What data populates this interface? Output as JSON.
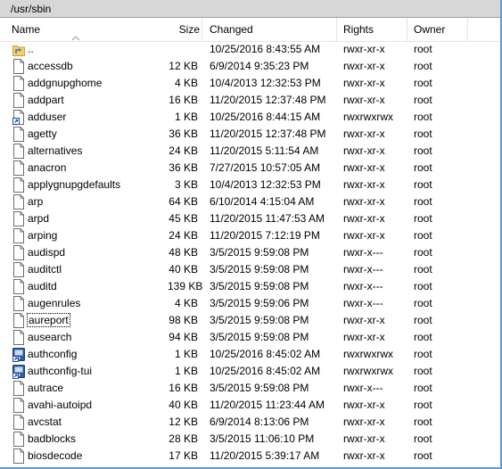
{
  "path": "/usr/sbin",
  "columns": {
    "name": "Name",
    "size": "Size",
    "changed": "Changed",
    "rights": "Rights",
    "owner": "Owner"
  },
  "files": [
    {
      "name": "..",
      "size": "",
      "changed": "10/25/2016 8:43:55 AM",
      "rights": "rwxr-xr-x",
      "owner": "root",
      "icon": "parent-folder-icon"
    },
    {
      "name": "accessdb",
      "size": "12 KB",
      "changed": "6/9/2014 9:35:23 PM",
      "rights": "rwxr-xr-x",
      "owner": "root",
      "icon": "file-icon"
    },
    {
      "name": "addgnupghome",
      "size": "4 KB",
      "changed": "10/4/2013 12:32:53 PM",
      "rights": "rwxr-xr-x",
      "owner": "root",
      "icon": "file-icon"
    },
    {
      "name": "addpart",
      "size": "16 KB",
      "changed": "11/20/2015 12:37:48 PM",
      "rights": "rwxr-xr-x",
      "owner": "root",
      "icon": "file-icon"
    },
    {
      "name": "adduser",
      "size": "1 KB",
      "changed": "10/25/2016 8:44:15 AM",
      "rights": "rwxrwxrwx",
      "owner": "root",
      "icon": "symlink-file-icon"
    },
    {
      "name": "agetty",
      "size": "36 KB",
      "changed": "11/20/2015 12:37:48 PM",
      "rights": "rwxr-xr-x",
      "owner": "root",
      "icon": "file-icon"
    },
    {
      "name": "alternatives",
      "size": "24 KB",
      "changed": "11/20/2015 5:11:54 AM",
      "rights": "rwxr-xr-x",
      "owner": "root",
      "icon": "file-icon"
    },
    {
      "name": "anacron",
      "size": "36 KB",
      "changed": "7/27/2015 10:57:05 AM",
      "rights": "rwxr-xr-x",
      "owner": "root",
      "icon": "file-icon"
    },
    {
      "name": "applygnupgdefaults",
      "size": "3 KB",
      "changed": "10/4/2013 12:32:53 PM",
      "rights": "rwxr-xr-x",
      "owner": "root",
      "icon": "file-icon"
    },
    {
      "name": "arp",
      "size": "64 KB",
      "changed": "6/10/2014 4:15:04 AM",
      "rights": "rwxr-xr-x",
      "owner": "root",
      "icon": "file-icon"
    },
    {
      "name": "arpd",
      "size": "45 KB",
      "changed": "11/20/2015 11:47:53 AM",
      "rights": "rwxr-xr-x",
      "owner": "root",
      "icon": "file-icon"
    },
    {
      "name": "arping",
      "size": "24 KB",
      "changed": "11/20/2015 7:12:19 PM",
      "rights": "rwxr-xr-x",
      "owner": "root",
      "icon": "file-icon"
    },
    {
      "name": "audispd",
      "size": "48 KB",
      "changed": "3/5/2015 9:59:08 PM",
      "rights": "rwxr-x---",
      "owner": "root",
      "icon": "file-icon"
    },
    {
      "name": "auditctl",
      "size": "40 KB",
      "changed": "3/5/2015 9:59:08 PM",
      "rights": "rwxr-x---",
      "owner": "root",
      "icon": "file-icon"
    },
    {
      "name": "auditd",
      "size": "139 KB",
      "changed": "3/5/2015 9:59:08 PM",
      "rights": "rwxr-x---",
      "owner": "root",
      "icon": "file-icon"
    },
    {
      "name": "augenrules",
      "size": "4 KB",
      "changed": "3/5/2015 9:59:06 PM",
      "rights": "rwxr-x---",
      "owner": "root",
      "icon": "file-icon"
    },
    {
      "name": "aureport",
      "size": "98 KB",
      "changed": "3/5/2015 9:59:08 PM",
      "rights": "rwxr-xr-x",
      "owner": "root",
      "icon": "file-icon",
      "focused": true
    },
    {
      "name": "ausearch",
      "size": "94 KB",
      "changed": "3/5/2015 9:59:08 PM",
      "rights": "rwxr-xr-x",
      "owner": "root",
      "icon": "file-icon"
    },
    {
      "name": "authconfig",
      "size": "1 KB",
      "changed": "10/25/2016 8:45:02 AM",
      "rights": "rwxrwxrwx",
      "owner": "root",
      "icon": "app-shortcut-icon"
    },
    {
      "name": "authconfig-tui",
      "size": "1 KB",
      "changed": "10/25/2016 8:45:02 AM",
      "rights": "rwxrwxrwx",
      "owner": "root",
      "icon": "app-shortcut-icon"
    },
    {
      "name": "autrace",
      "size": "16 KB",
      "changed": "3/5/2015 9:59:08 PM",
      "rights": "rwxr-x---",
      "owner": "root",
      "icon": "file-icon"
    },
    {
      "name": "avahi-autoipd",
      "size": "40 KB",
      "changed": "11/20/2015 11:23:44 AM",
      "rights": "rwxr-xr-x",
      "owner": "root",
      "icon": "file-icon"
    },
    {
      "name": "avcstat",
      "size": "12 KB",
      "changed": "6/9/2014 8:13:06 PM",
      "rights": "rwxr-xr-x",
      "owner": "root",
      "icon": "file-icon"
    },
    {
      "name": "badblocks",
      "size": "28 KB",
      "changed": "3/5/2015 11:06:10 PM",
      "rights": "rwxr-xr-x",
      "owner": "root",
      "icon": "file-icon"
    },
    {
      "name": "biosdecode",
      "size": "17 KB",
      "changed": "11/20/2015 5:39:17 AM",
      "rights": "rwxr-xr-x",
      "owner": "root",
      "icon": "file-icon"
    }
  ],
  "colors": {
    "frame_border": "#5d9ad6",
    "pathbar_bg": "#d7d7d7",
    "header_separator": "#e5e5e5"
  }
}
